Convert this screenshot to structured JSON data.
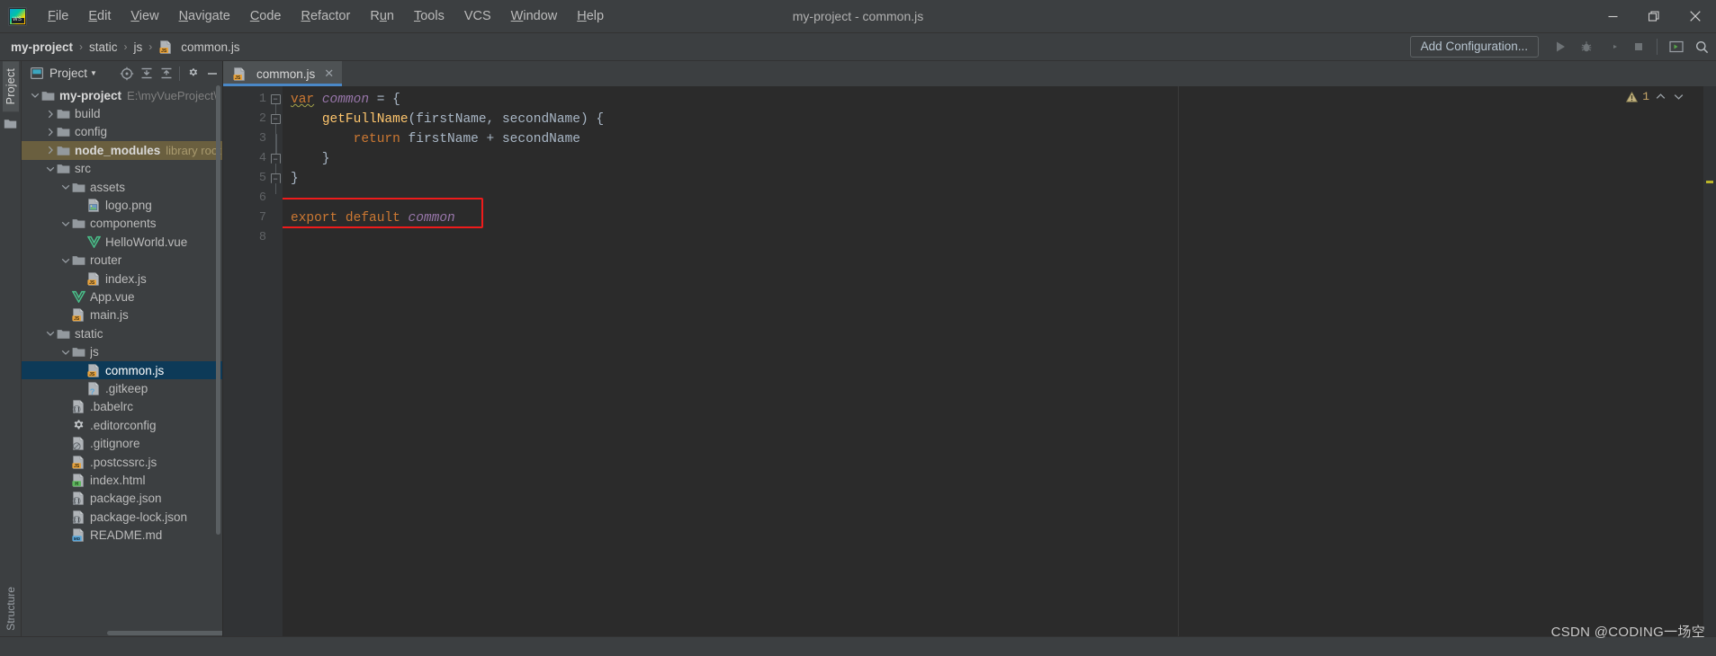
{
  "window": {
    "title": "my-project - common.js",
    "app_icon": "webstorm-logo-icon",
    "minimize_label": "–",
    "maximize_label": "❐",
    "close_label": "✕"
  },
  "menu": {
    "items": [
      {
        "label": "File",
        "mnemonic": "F"
      },
      {
        "label": "Edit",
        "mnemonic": "E"
      },
      {
        "label": "View",
        "mnemonic": "V"
      },
      {
        "label": "Navigate",
        "mnemonic": "N"
      },
      {
        "label": "Code",
        "mnemonic": "C"
      },
      {
        "label": "Refactor",
        "mnemonic": "R"
      },
      {
        "label": "Run",
        "mnemonic": "u"
      },
      {
        "label": "Tools",
        "mnemonic": "T"
      },
      {
        "label": "VCS",
        "mnemonic": ""
      },
      {
        "label": "Window",
        "mnemonic": "W"
      },
      {
        "label": "Help",
        "mnemonic": "H"
      }
    ]
  },
  "breadcrumb": {
    "separator": "›",
    "items": [
      {
        "label": "my-project",
        "bold": true,
        "icon": ""
      },
      {
        "label": "static",
        "bold": false,
        "icon": ""
      },
      {
        "label": "js",
        "bold": false,
        "icon": ""
      },
      {
        "label": "common.js",
        "bold": false,
        "icon": "js-file-icon"
      }
    ]
  },
  "toolbar": {
    "add_configuration_label": "Add Configuration...",
    "run_label": "Run",
    "debug_label": "Debug",
    "run_coverage_label": "Run with Coverage",
    "stop_label": "Stop",
    "console_label": "Console",
    "search_label": "Search Everywhere"
  },
  "left_strip": {
    "tab_label": "Project",
    "structure_label": "Structure",
    "folder_icon": "folder-icon"
  },
  "project_panel": {
    "title": "Project",
    "dropdown_icon": "chevron-down-icon",
    "buttons": [
      {
        "name": "locate-icon",
        "label": "Select Opened File"
      },
      {
        "name": "expand-all-icon",
        "label": "Expand All"
      },
      {
        "name": "collapse-all-icon",
        "label": "Collapse All"
      },
      {
        "name": "gear-icon",
        "label": "Settings"
      },
      {
        "name": "minimize-icon",
        "label": "Hide"
      }
    ],
    "tree": [
      {
        "label": "my-project",
        "sub": "E:\\myVueProject\\",
        "indent": 0,
        "arrow": "expanded",
        "icon": "folder-icon",
        "bold": true,
        "selected": false,
        "highlight": false,
        "sub_class": "path"
      },
      {
        "label": "build",
        "sub": "",
        "indent": 1,
        "arrow": "collapsed",
        "icon": "folder-icon",
        "bold": false,
        "selected": false,
        "highlight": false
      },
      {
        "label": "config",
        "sub": "",
        "indent": 1,
        "arrow": "collapsed",
        "icon": "folder-icon",
        "bold": false,
        "selected": false,
        "highlight": false
      },
      {
        "label": "node_modules",
        "sub": "library root",
        "indent": 1,
        "arrow": "collapsed",
        "icon": "folder-icon",
        "bold": true,
        "selected": false,
        "highlight": true,
        "sub_class": "lib"
      },
      {
        "label": "src",
        "sub": "",
        "indent": 1,
        "arrow": "expanded",
        "icon": "folder-icon",
        "bold": false,
        "selected": false,
        "highlight": false
      },
      {
        "label": "assets",
        "sub": "",
        "indent": 2,
        "arrow": "expanded",
        "icon": "folder-icon",
        "bold": false,
        "selected": false,
        "highlight": false
      },
      {
        "label": "logo.png",
        "sub": "",
        "indent": 3,
        "arrow": "none",
        "icon": "image-file-icon",
        "bold": false,
        "selected": false,
        "highlight": false
      },
      {
        "label": "components",
        "sub": "",
        "indent": 2,
        "arrow": "expanded",
        "icon": "folder-icon",
        "bold": false,
        "selected": false,
        "highlight": false
      },
      {
        "label": "HelloWorld.vue",
        "sub": "",
        "indent": 3,
        "arrow": "none",
        "icon": "vue-file-icon",
        "bold": false,
        "selected": false,
        "highlight": false
      },
      {
        "label": "router",
        "sub": "",
        "indent": 2,
        "arrow": "expanded",
        "icon": "folder-icon",
        "bold": false,
        "selected": false,
        "highlight": false
      },
      {
        "label": "index.js",
        "sub": "",
        "indent": 3,
        "arrow": "none",
        "icon": "js-file-icon",
        "bold": false,
        "selected": false,
        "highlight": false
      },
      {
        "label": "App.vue",
        "sub": "",
        "indent": 2,
        "arrow": "none",
        "icon": "vue-file-icon",
        "bold": false,
        "selected": false,
        "highlight": false
      },
      {
        "label": "main.js",
        "sub": "",
        "indent": 2,
        "arrow": "none",
        "icon": "js-file-icon",
        "bold": false,
        "selected": false,
        "highlight": false
      },
      {
        "label": "static",
        "sub": "",
        "indent": 1,
        "arrow": "expanded",
        "icon": "folder-icon",
        "bold": false,
        "selected": false,
        "highlight": false
      },
      {
        "label": "js",
        "sub": "",
        "indent": 2,
        "arrow": "expanded",
        "icon": "folder-icon",
        "bold": false,
        "selected": false,
        "highlight": false
      },
      {
        "label": "common.js",
        "sub": "",
        "indent": 3,
        "arrow": "none",
        "icon": "js-file-icon",
        "bold": false,
        "selected": true,
        "highlight": false
      },
      {
        "label": ".gitkeep",
        "sub": "",
        "indent": 3,
        "arrow": "none",
        "icon": "unknown-file-icon",
        "bold": false,
        "selected": false,
        "highlight": false
      },
      {
        "label": ".babelrc",
        "sub": "",
        "indent": 2,
        "arrow": "none",
        "icon": "json-file-icon",
        "bold": false,
        "selected": false,
        "highlight": false
      },
      {
        "label": ".editorconfig",
        "sub": "",
        "indent": 2,
        "arrow": "none",
        "icon": "gear-file-icon",
        "bold": false,
        "selected": false,
        "highlight": false
      },
      {
        "label": ".gitignore",
        "sub": "",
        "indent": 2,
        "arrow": "none",
        "icon": "gitignore-file-icon",
        "bold": false,
        "selected": false,
        "highlight": false
      },
      {
        "label": ".postcssrc.js",
        "sub": "",
        "indent": 2,
        "arrow": "none",
        "icon": "js-file-icon",
        "bold": false,
        "selected": false,
        "highlight": false
      },
      {
        "label": "index.html",
        "sub": "",
        "indent": 2,
        "arrow": "none",
        "icon": "html-file-icon",
        "bold": false,
        "selected": false,
        "highlight": false
      },
      {
        "label": "package.json",
        "sub": "",
        "indent": 2,
        "arrow": "none",
        "icon": "json-file-icon",
        "bold": false,
        "selected": false,
        "highlight": false
      },
      {
        "label": "package-lock.json",
        "sub": "",
        "indent": 2,
        "arrow": "none",
        "icon": "json-file-icon",
        "bold": false,
        "selected": false,
        "highlight": false
      },
      {
        "label": "README.md",
        "sub": "",
        "indent": 2,
        "arrow": "none",
        "icon": "md-file-icon",
        "bold": false,
        "selected": false,
        "highlight": false
      }
    ]
  },
  "editor": {
    "tabs": [
      {
        "label": "common.js",
        "icon": "js-file-icon",
        "active": true,
        "close_label": "✕"
      }
    ],
    "line_numbers": [
      "1",
      "2",
      "3",
      "4",
      "5",
      "6",
      "7",
      "8"
    ],
    "lines": [
      {
        "n": 1,
        "tokens": [
          {
            "t": "var",
            "c": "kw squig"
          },
          {
            "t": " ",
            "c": "op"
          },
          {
            "t": "common",
            "c": "var-it"
          },
          {
            "t": " = {",
            "c": "op"
          }
        ]
      },
      {
        "n": 2,
        "tokens": [
          {
            "t": "    ",
            "c": "op"
          },
          {
            "t": "getFullName",
            "c": "fn"
          },
          {
            "t": "(firstName, secondName) {",
            "c": "op"
          }
        ]
      },
      {
        "n": 3,
        "tokens": [
          {
            "t": "        ",
            "c": "op"
          },
          {
            "t": "return",
            "c": "kw"
          },
          {
            "t": " firstName + secondName",
            "c": "op"
          }
        ]
      },
      {
        "n": 4,
        "tokens": [
          {
            "t": "    }",
            "c": "op"
          }
        ]
      },
      {
        "n": 5,
        "tokens": [
          {
            "t": "}",
            "c": "op"
          }
        ]
      },
      {
        "n": 6,
        "tokens": []
      },
      {
        "n": 7,
        "tokens": [
          {
            "t": "export default",
            "c": "kw"
          },
          {
            "t": " ",
            "c": "op"
          },
          {
            "t": "common",
            "c": "var-it"
          }
        ]
      },
      {
        "n": 8,
        "tokens": []
      }
    ],
    "highlight_box": {
      "line": 7,
      "color": "#ee1b1b"
    },
    "inspection": {
      "warning_count": "1",
      "icon": "warning-triangle-icon",
      "prev_label": "^",
      "next_label": "v"
    }
  },
  "watermark": {
    "text": "CSDN @CODING一场空"
  },
  "colors": {
    "background": "#3c3f41",
    "editor_background": "#2b2b2b",
    "gutter": "#313335",
    "selection": "#0d3a58",
    "tab_accent": "#4a88c7",
    "keyword": "#cc7832",
    "function": "#ffc66d",
    "variable": "#9876aa",
    "text": "#a9b7c6",
    "warning": "#bbb529",
    "error_box": "#ee1b1b",
    "library_highlight": "#6a5f3f"
  }
}
